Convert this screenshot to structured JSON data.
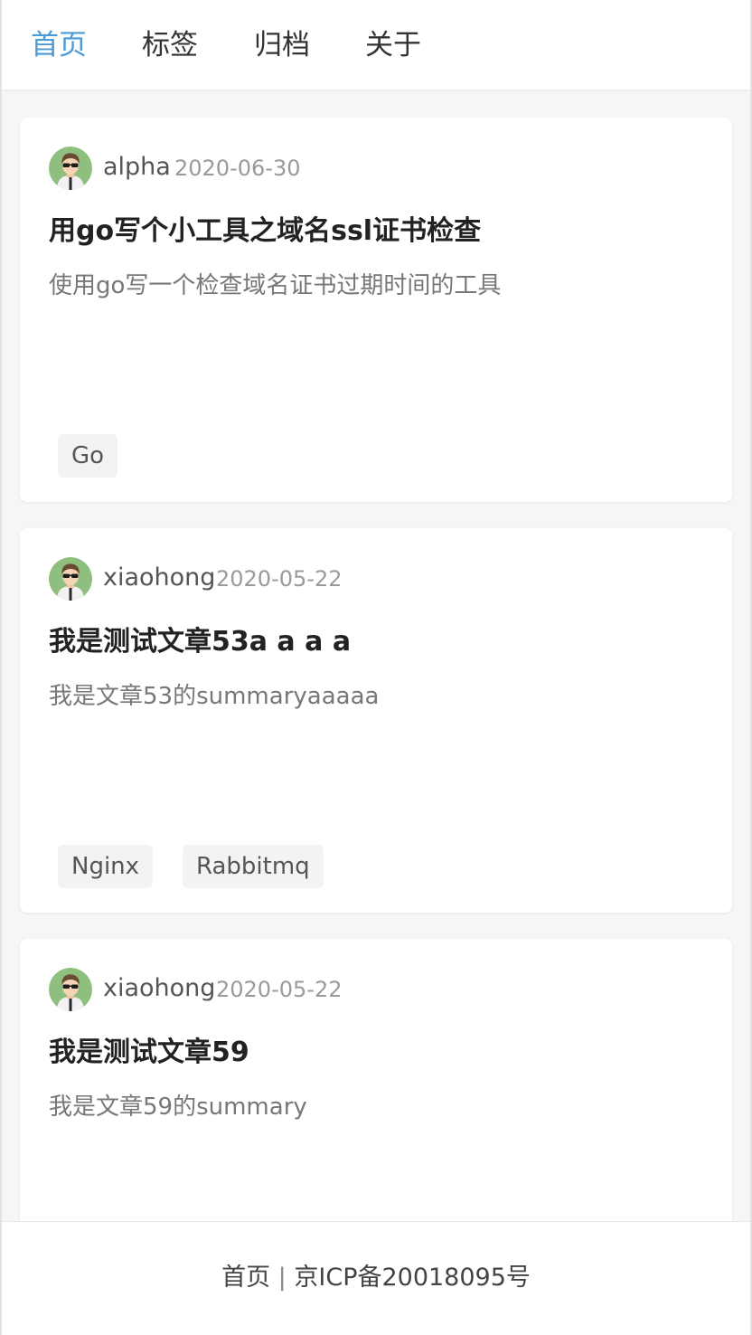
{
  "nav": {
    "items": [
      {
        "label": "首页",
        "active": true
      },
      {
        "label": "标签",
        "active": false
      },
      {
        "label": "归档",
        "active": false
      },
      {
        "label": "关于",
        "active": false
      }
    ],
    "accent_color": "#4a9ad8"
  },
  "posts": [
    {
      "author": "alpha",
      "date": "2020-06-30",
      "title": "用go写个小工具之域名ssl证书检查",
      "summary": "使用go写一个检查域名证书过期时间的工具",
      "tags": [
        "Go"
      ],
      "avatar_icon": "user-avatar-sunglasses-icon"
    },
    {
      "author": "xiaohong",
      "date": "2020-05-22",
      "title": "我是测试文章53a a a a",
      "summary": "我是文章53的summaryaaaaa",
      "tags": [
        "Nginx",
        "Rabbitmq"
      ],
      "avatar_icon": "user-avatar-sunglasses-icon"
    },
    {
      "author": "xiaohong",
      "date": "2020-05-22",
      "title": "我是测试文章59",
      "summary": "我是文章59的summary",
      "tags": [],
      "avatar_icon": "user-avatar-sunglasses-icon"
    }
  ],
  "footer": {
    "home_link": "首页",
    "separator": "|",
    "icp": "京ICP备20018095号"
  }
}
